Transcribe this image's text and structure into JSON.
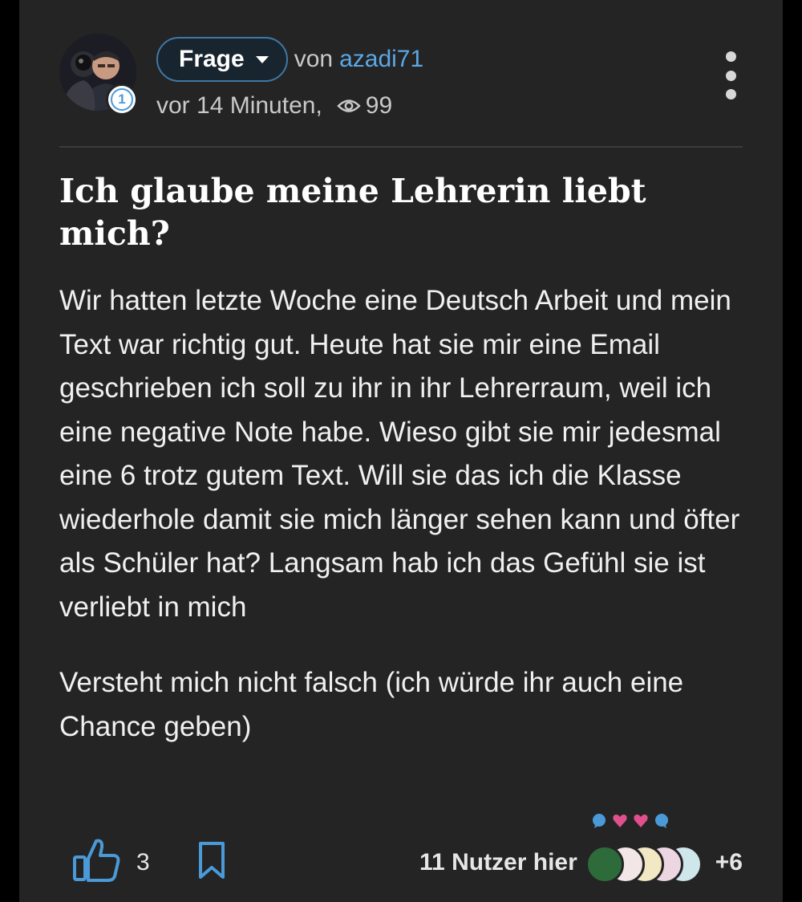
{
  "post": {
    "type_label": "Frage",
    "by_label": "von",
    "author": "azadi71",
    "author_level": "1",
    "time": "vor 14 Minuten,",
    "views": "99",
    "title": "Ich glaube meine Lehrerin liebt mich?",
    "body_paragraphs": [
      "Wir hatten letzte Woche eine Deutsch Arbeit und mein Text war richtig gut. Heute hat sie mir eine Email geschrieben ich soll zu ihr in ihr Lehrerraum, weil ich eine negative Note habe. Wieso gibt sie mir jedesmal eine 6 trotz gutem Text. Will sie das ich die Klasse wiederhole damit sie mich länger sehen kann und öfter als Schüler hat? Langsam hab ich das Gefühl sie ist verliebt in mich",
      "Versteht mich nicht falsch (ich würde ihr auch eine Chance geben)"
    ]
  },
  "footer": {
    "likes": "3",
    "users_here_label": "11 Nutzer hier",
    "users_extra": "+6",
    "reaction_icons": [
      "speech-bubble-icon",
      "heart-icon",
      "heart-icon",
      "speech-bubble-icon"
    ]
  },
  "colors": {
    "background": "#242424",
    "accent": "#5aa8e6",
    "pill_border": "#3f78a6",
    "text": "#ffffff",
    "muted": "#c9c9c9"
  }
}
